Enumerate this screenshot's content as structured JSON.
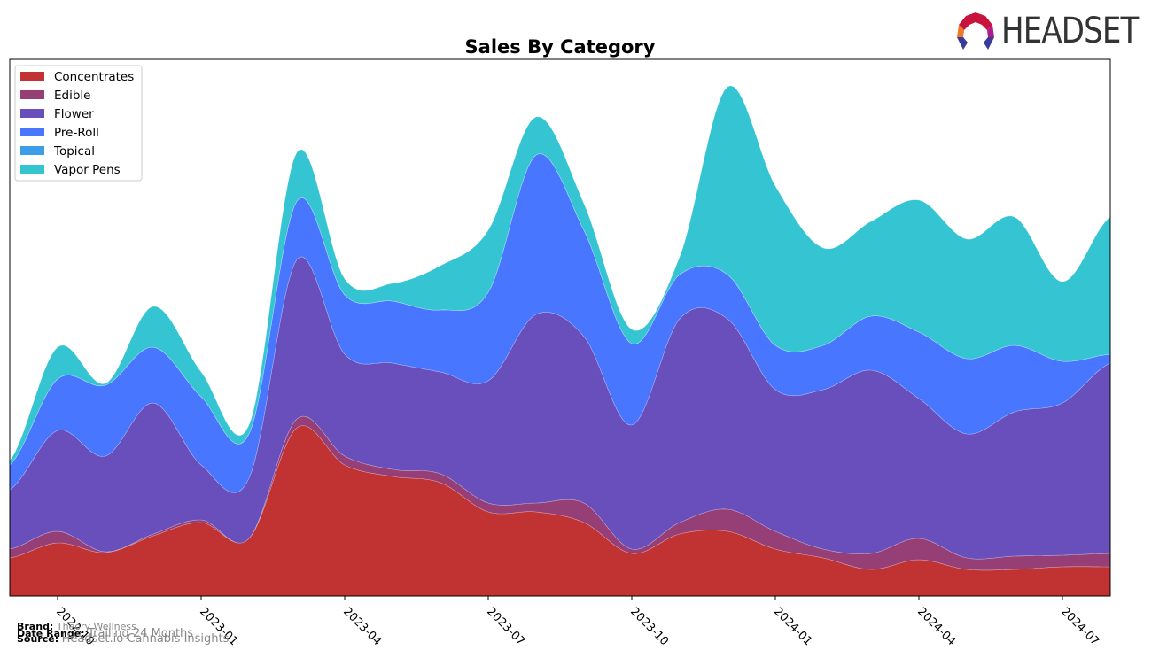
{
  "logo": {
    "text": "HEADSET"
  },
  "footer": {
    "brand_label": "Brand:",
    "brand_value": "Theory Wellness",
    "date_label": "Date Range:",
    "date_value": "Trailing 24 Months",
    "source_label": "Source:",
    "source_value": "Headset.io Cannabis Insights"
  },
  "chart_data": {
    "type": "area",
    "stacked": true,
    "smoothed": true,
    "title": "Sales By Category",
    "xlabel": "",
    "ylabel": "",
    "grid": false,
    "legend_position": "top-left",
    "x": [
      "2022-09",
      "2022-10",
      "2022-11",
      "2022-12",
      "2023-01",
      "2023-02",
      "2023-03",
      "2023-04",
      "2023-05",
      "2023-06",
      "2023-07",
      "2023-08",
      "2023-09",
      "2023-10",
      "2023-11",
      "2023-12",
      "2024-01",
      "2024-02",
      "2024-03",
      "2024-04",
      "2024-05",
      "2024-06",
      "2024-07",
      "2024-08"
    ],
    "x_ticks": [
      "2022-10",
      "2023-01",
      "2023-04",
      "2023-07",
      "2023-10",
      "2024-01",
      "2024-04",
      "2024-07"
    ],
    "ylim": [
      0,
      606
    ],
    "series": [
      {
        "name": "Concentrates",
        "color": "#c13232",
        "values": [
          43,
          60,
          49,
          68,
          83,
          65,
          190,
          148,
          135,
          128,
          95,
          95,
          83,
          48,
          70,
          73,
          53,
          43,
          30,
          41,
          30,
          30,
          33,
          33
        ]
      },
      {
        "name": "Edible",
        "color": "#953f76",
        "values": [
          10,
          13,
          1,
          2,
          3,
          0,
          10,
          10,
          8,
          10,
          10,
          10,
          22,
          5,
          13,
          25,
          20,
          10,
          18,
          24,
          13,
          15,
          13,
          15
        ]
      },
      {
        "name": "Flower",
        "color": "#684fbc",
        "values": [
          67,
          114,
          108,
          148,
          62,
          68,
          180,
          115,
          120,
          115,
          138,
          213,
          188,
          140,
          230,
          215,
          160,
          180,
          207,
          158,
          140,
          163,
          172,
          215
        ]
      },
      {
        "name": "Pre-Roll",
        "color": "#4876fe",
        "values": [
          28,
          58,
          80,
          63,
          77,
          50,
          66,
          67,
          70,
          70,
          100,
          180,
          120,
          92,
          50,
          50,
          50,
          50,
          61,
          75,
          85,
          75,
          47,
          10
        ]
      },
      {
        "name": "Topical",
        "color": "#3d9ee8",
        "values": [
          0,
          0,
          0,
          0,
          0,
          0,
          0,
          0,
          0,
          0,
          0,
          0,
          0,
          0,
          0,
          0,
          0,
          0,
          0,
          0,
          0,
          0,
          0,
          0
        ]
      },
      {
        "name": "Vapor Pens",
        "color": "#35c4d2",
        "values": [
          5,
          36,
          2,
          46,
          28,
          10,
          55,
          18,
          20,
          50,
          70,
          43,
          30,
          16,
          20,
          212,
          180,
          110,
          107,
          149,
          135,
          145,
          90,
          155
        ]
      }
    ]
  }
}
